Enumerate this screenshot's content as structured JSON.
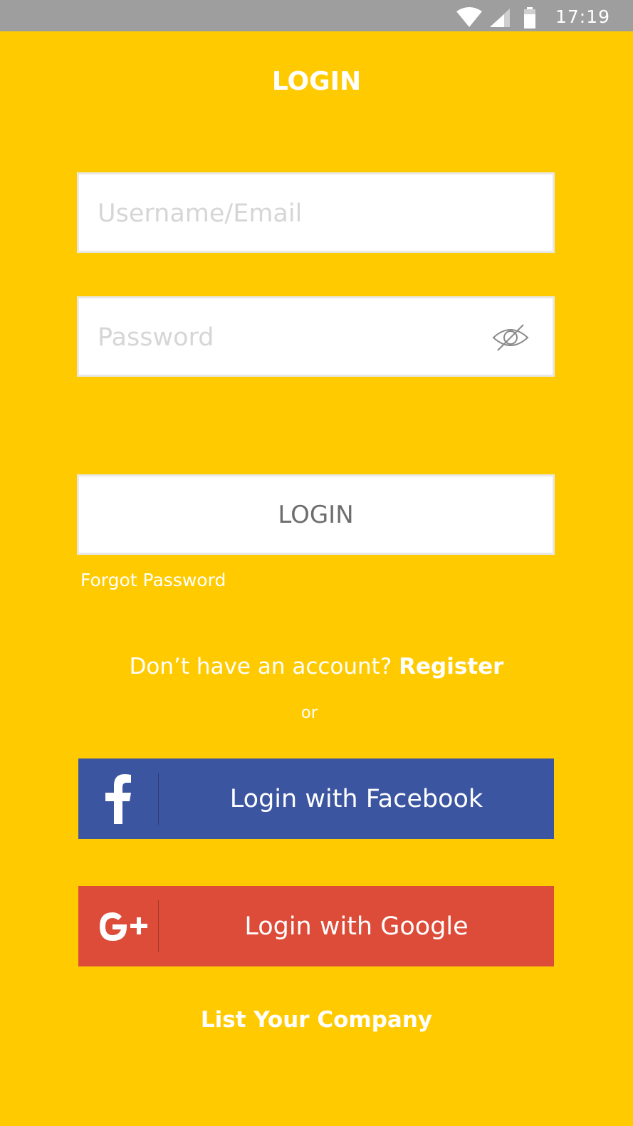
{
  "status_bar": {
    "time": "17:19",
    "icons": [
      "wifi-icon",
      "cellular-signal-icon",
      "battery-icon"
    ]
  },
  "header": {
    "title": "LOGIN"
  },
  "form": {
    "username_placeholder": "Username/Email",
    "username_value": "",
    "password_placeholder": "Password",
    "password_value": "",
    "password_toggle_icon": "eye-off-icon",
    "login_label": "LOGIN",
    "forgot_password": "Forgot Password"
  },
  "register": {
    "prompt": "Don’t have an account?",
    "link": "Register"
  },
  "separator": "or",
  "social": {
    "facebook": {
      "label": "Login with Facebook",
      "icon": "facebook-icon",
      "color": "#3B55A0"
    },
    "google": {
      "label": "Login with Google",
      "icon": "google-plus-icon",
      "color": "#DD4B39"
    }
  },
  "footer": {
    "list_company": "List Your Company"
  },
  "colors": {
    "background": "#FFCB00",
    "status_bar": "#9E9E9E",
    "text_light": "#FFFFFF",
    "field_border": "#E8E8E8"
  }
}
